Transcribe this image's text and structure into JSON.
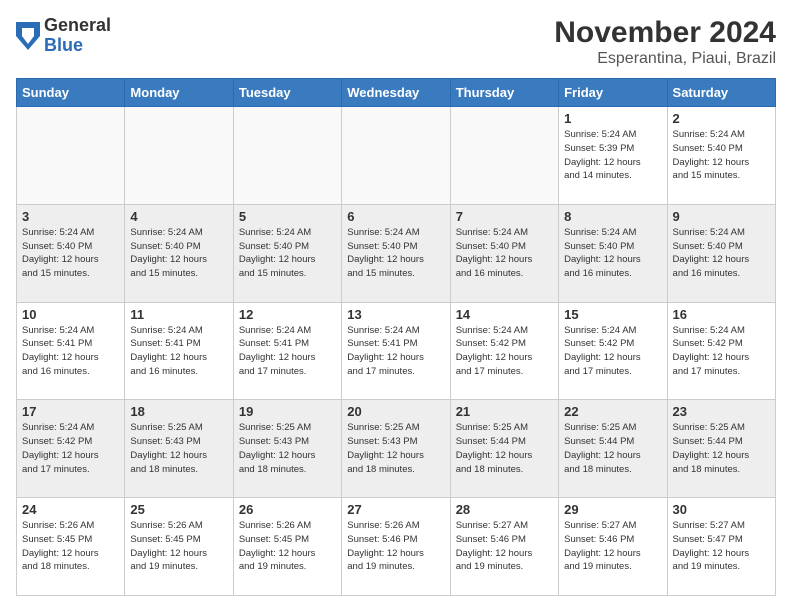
{
  "header": {
    "logo_line1": "General",
    "logo_line2": "Blue",
    "title": "November 2024",
    "subtitle": "Esperantina, Piaui, Brazil"
  },
  "weekdays": [
    "Sunday",
    "Monday",
    "Tuesday",
    "Wednesday",
    "Thursday",
    "Friday",
    "Saturday"
  ],
  "weeks": [
    [
      {
        "day": "",
        "info": ""
      },
      {
        "day": "",
        "info": ""
      },
      {
        "day": "",
        "info": ""
      },
      {
        "day": "",
        "info": ""
      },
      {
        "day": "",
        "info": ""
      },
      {
        "day": "1",
        "info": "Sunrise: 5:24 AM\nSunset: 5:39 PM\nDaylight: 12 hours\nand 14 minutes."
      },
      {
        "day": "2",
        "info": "Sunrise: 5:24 AM\nSunset: 5:40 PM\nDaylight: 12 hours\nand 15 minutes."
      }
    ],
    [
      {
        "day": "3",
        "info": "Sunrise: 5:24 AM\nSunset: 5:40 PM\nDaylight: 12 hours\nand 15 minutes."
      },
      {
        "day": "4",
        "info": "Sunrise: 5:24 AM\nSunset: 5:40 PM\nDaylight: 12 hours\nand 15 minutes."
      },
      {
        "day": "5",
        "info": "Sunrise: 5:24 AM\nSunset: 5:40 PM\nDaylight: 12 hours\nand 15 minutes."
      },
      {
        "day": "6",
        "info": "Sunrise: 5:24 AM\nSunset: 5:40 PM\nDaylight: 12 hours\nand 15 minutes."
      },
      {
        "day": "7",
        "info": "Sunrise: 5:24 AM\nSunset: 5:40 PM\nDaylight: 12 hours\nand 16 minutes."
      },
      {
        "day": "8",
        "info": "Sunrise: 5:24 AM\nSunset: 5:40 PM\nDaylight: 12 hours\nand 16 minutes."
      },
      {
        "day": "9",
        "info": "Sunrise: 5:24 AM\nSunset: 5:40 PM\nDaylight: 12 hours\nand 16 minutes."
      }
    ],
    [
      {
        "day": "10",
        "info": "Sunrise: 5:24 AM\nSunset: 5:41 PM\nDaylight: 12 hours\nand 16 minutes."
      },
      {
        "day": "11",
        "info": "Sunrise: 5:24 AM\nSunset: 5:41 PM\nDaylight: 12 hours\nand 16 minutes."
      },
      {
        "day": "12",
        "info": "Sunrise: 5:24 AM\nSunset: 5:41 PM\nDaylight: 12 hours\nand 17 minutes."
      },
      {
        "day": "13",
        "info": "Sunrise: 5:24 AM\nSunset: 5:41 PM\nDaylight: 12 hours\nand 17 minutes."
      },
      {
        "day": "14",
        "info": "Sunrise: 5:24 AM\nSunset: 5:42 PM\nDaylight: 12 hours\nand 17 minutes."
      },
      {
        "day": "15",
        "info": "Sunrise: 5:24 AM\nSunset: 5:42 PM\nDaylight: 12 hours\nand 17 minutes."
      },
      {
        "day": "16",
        "info": "Sunrise: 5:24 AM\nSunset: 5:42 PM\nDaylight: 12 hours\nand 17 minutes."
      }
    ],
    [
      {
        "day": "17",
        "info": "Sunrise: 5:24 AM\nSunset: 5:42 PM\nDaylight: 12 hours\nand 17 minutes."
      },
      {
        "day": "18",
        "info": "Sunrise: 5:25 AM\nSunset: 5:43 PM\nDaylight: 12 hours\nand 18 minutes."
      },
      {
        "day": "19",
        "info": "Sunrise: 5:25 AM\nSunset: 5:43 PM\nDaylight: 12 hours\nand 18 minutes."
      },
      {
        "day": "20",
        "info": "Sunrise: 5:25 AM\nSunset: 5:43 PM\nDaylight: 12 hours\nand 18 minutes."
      },
      {
        "day": "21",
        "info": "Sunrise: 5:25 AM\nSunset: 5:44 PM\nDaylight: 12 hours\nand 18 minutes."
      },
      {
        "day": "22",
        "info": "Sunrise: 5:25 AM\nSunset: 5:44 PM\nDaylight: 12 hours\nand 18 minutes."
      },
      {
        "day": "23",
        "info": "Sunrise: 5:25 AM\nSunset: 5:44 PM\nDaylight: 12 hours\nand 18 minutes."
      }
    ],
    [
      {
        "day": "24",
        "info": "Sunrise: 5:26 AM\nSunset: 5:45 PM\nDaylight: 12 hours\nand 18 minutes."
      },
      {
        "day": "25",
        "info": "Sunrise: 5:26 AM\nSunset: 5:45 PM\nDaylight: 12 hours\nand 19 minutes."
      },
      {
        "day": "26",
        "info": "Sunrise: 5:26 AM\nSunset: 5:45 PM\nDaylight: 12 hours\nand 19 minutes."
      },
      {
        "day": "27",
        "info": "Sunrise: 5:26 AM\nSunset: 5:46 PM\nDaylight: 12 hours\nand 19 minutes."
      },
      {
        "day": "28",
        "info": "Sunrise: 5:27 AM\nSunset: 5:46 PM\nDaylight: 12 hours\nand 19 minutes."
      },
      {
        "day": "29",
        "info": "Sunrise: 5:27 AM\nSunset: 5:46 PM\nDaylight: 12 hours\nand 19 minutes."
      },
      {
        "day": "30",
        "info": "Sunrise: 5:27 AM\nSunset: 5:47 PM\nDaylight: 12 hours\nand 19 minutes."
      }
    ]
  ]
}
